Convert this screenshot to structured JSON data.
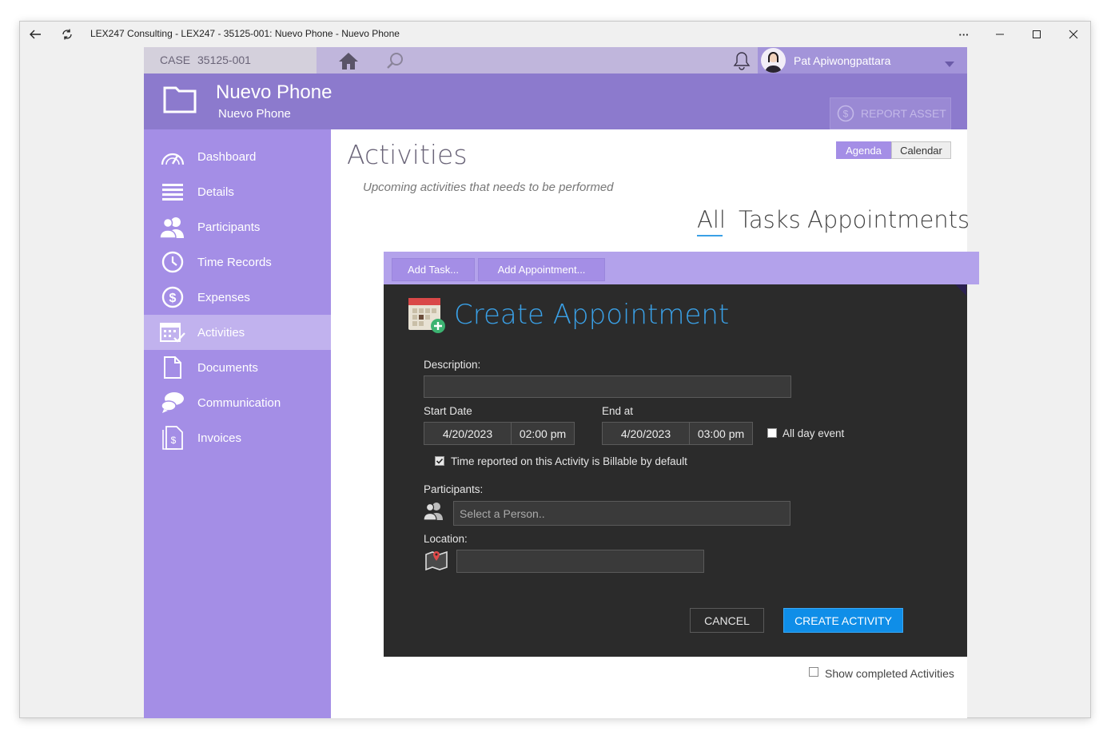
{
  "window": {
    "title": "LEX247 Consulting - LEX247 - 35125-001: Nuevo Phone - Nuevo Phone",
    "more_label": "···"
  },
  "topbar": {
    "case_label": "CASE",
    "case_number": "35125-001",
    "user_name": "Pat Apiwongpattara"
  },
  "header": {
    "title": "Nuevo Phone",
    "subtitle": "Nuevo Phone",
    "report_asset_label": "REPORT ASSET"
  },
  "sidebar": {
    "items": [
      {
        "label": "Dashboard",
        "icon": "gauge-icon"
      },
      {
        "label": "Details",
        "icon": "list-icon"
      },
      {
        "label": "Participants",
        "icon": "people-icon"
      },
      {
        "label": "Time Records",
        "icon": "clock-icon"
      },
      {
        "label": "Expenses",
        "icon": "dollar-icon"
      },
      {
        "label": "Activities",
        "icon": "calendar-check-icon"
      },
      {
        "label": "Documents",
        "icon": "document-icon"
      },
      {
        "label": "Communication",
        "icon": "chat-icon"
      },
      {
        "label": "Invoices",
        "icon": "invoice-icon"
      }
    ],
    "active_index": 5
  },
  "main": {
    "title": "Activities",
    "subtitle": "Upcoming activities that needs to be performed",
    "view_toggle": {
      "agenda": "Agenda",
      "calendar": "Calendar"
    },
    "tabs": {
      "all": "All",
      "tasks": "Tasks",
      "appointments": "Appointments"
    },
    "toolbar": {
      "add_task": "Add Task...",
      "add_appointment": "Add Appointment..."
    },
    "show_completed_label": "Show completed Activities"
  },
  "dialog": {
    "title": "Create Appointment",
    "description_label": "Description:",
    "description_value": "",
    "start_label": "Start Date",
    "start_date": "4/20/2023",
    "start_time": "02:00 pm",
    "end_label": "End at",
    "end_date": "4/20/2023",
    "end_time": "03:00 pm",
    "all_day_label": "All day event",
    "billable_label": "Time reported on this Activity is Billable by default",
    "participants_label": "Participants:",
    "participants_placeholder": "Select a Person..",
    "location_label": "Location:",
    "location_value": "",
    "cancel_label": "CANCEL",
    "create_label": "CREATE ACTIVITY"
  },
  "colors": {
    "sidebar": "#a48ee6",
    "header": "#8c7acd",
    "dialog_bg": "#2b2b2b",
    "accent_blue": "#0f8ee8",
    "title_blue": "#3aa0e6"
  }
}
